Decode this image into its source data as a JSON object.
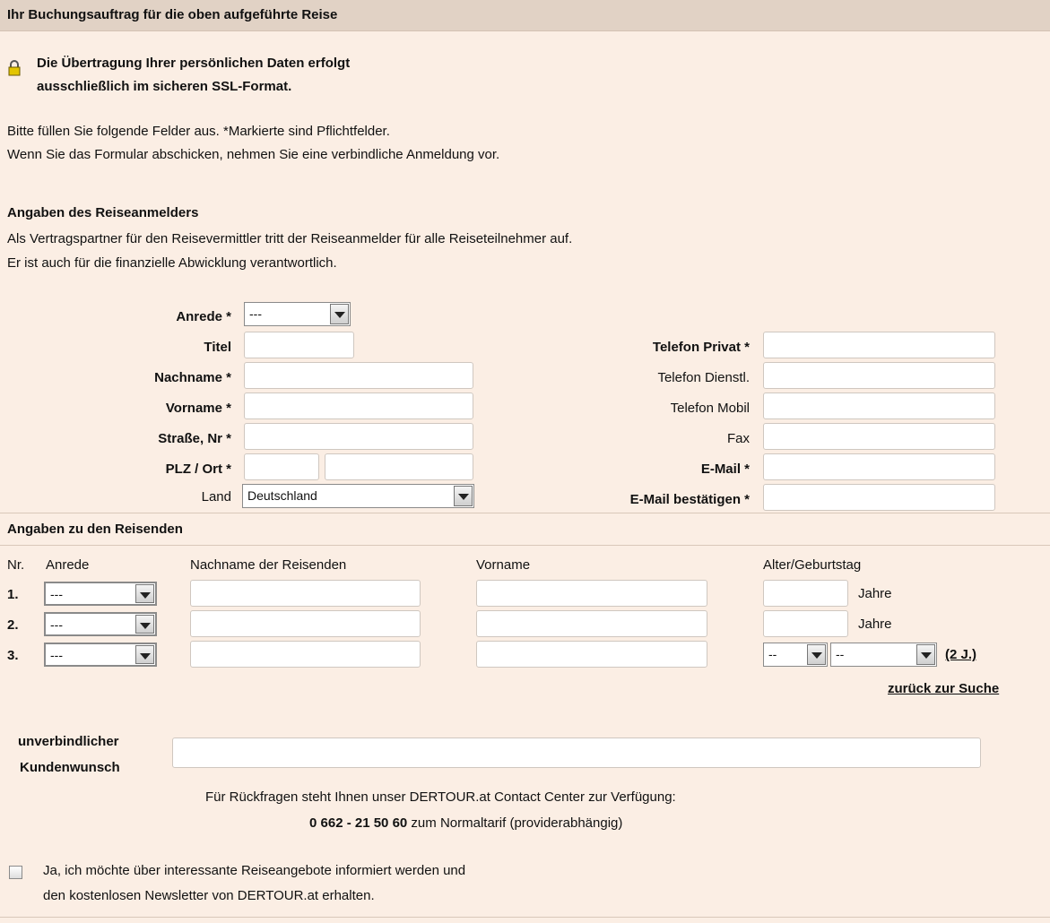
{
  "header": {
    "title": "Ihr Buchungsauftrag für die oben aufgeführte Reise"
  },
  "ssl": {
    "line1": "Die Übertragung Ihrer persönlichen Daten erfolgt",
    "line2": "ausschließlich im sicheren SSL-Format."
  },
  "intro": {
    "line1": "Bitte füllen Sie folgende Felder aus. *Markierte sind Pflichtfelder.",
    "line2": "Wenn Sie das Formular abschicken, nehmen Sie eine verbindliche Anmeldung vor."
  },
  "applicant": {
    "heading": "Angaben des Reiseanmelders",
    "desc1": "Als Vertragspartner für den Reisevermittler tritt der Reiseanmelder für alle Reiseteilnehmer auf.",
    "desc2": "Er ist auch für die finanzielle Abwicklung verantwortlich.",
    "labels": {
      "anrede": "Anrede *",
      "titel": "Titel",
      "nachname": "Nachname *",
      "vorname": "Vorname *",
      "strasse": "Straße, Nr *",
      "plz_ort": "PLZ / Ort *",
      "land": "Land",
      "tel_privat": "Telefon Privat *",
      "tel_dienst": "Telefon Dienstl.",
      "tel_mobil": "Telefon Mobil",
      "fax": "Fax",
      "email": "E-Mail *",
      "email_confirm": "E-Mail bestätigen *"
    },
    "anrede_value": "---",
    "land_value": "Deutschland"
  },
  "travelers": {
    "heading": "Angaben zu den Reisenden",
    "columns": {
      "nr": "Nr.",
      "anrede": "Anrede",
      "nachname": "Nachname der Reisenden",
      "vorname": "Vorname",
      "alter": "Alter/Geburtstag"
    },
    "rows": [
      {
        "nr": "1.",
        "anrede": "---",
        "unit": "Jahre"
      },
      {
        "nr": "2.",
        "anrede": "---",
        "unit": "Jahre"
      },
      {
        "nr": "3.",
        "anrede": "---",
        "day": "--",
        "month": "--",
        "note": "(2 J.)"
      }
    ]
  },
  "back_link": "zurück zur Suche",
  "wish": {
    "label1": "unverbindlicher",
    "label2": "Kundenwunsch"
  },
  "contact": {
    "line1": "Für Rückfragen steht Ihnen unser DERTOUR.at Contact Center zur Verfügung:",
    "phone": "0 662 - 21 50 60",
    "line2_rest": " zum Normaltarif (providerabhängig)"
  },
  "newsletter": {
    "line1": "Ja, ich möchte über interessante Reiseangebote informiert werden und",
    "line2": "den kostenlosen Newsletter von DERTOUR.at erhalten."
  }
}
